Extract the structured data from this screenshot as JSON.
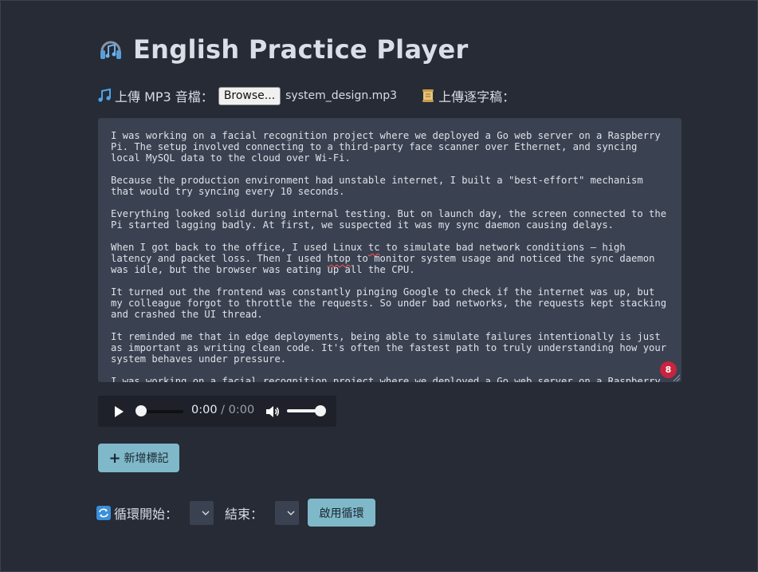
{
  "app": {
    "title": "English Practice Player",
    "title_icon": "headphones-icon"
  },
  "upload": {
    "mp3_label": "上傳 MP3 音檔：",
    "mp3_icon": "music-note-icon",
    "browse_label": "Browse...",
    "file_name": "system_design.mp3",
    "transcript_label": "上傳逐字稿：",
    "transcript_icon": "scroll-icon"
  },
  "transcript": {
    "paragraphs": [
      "I was working on a facial recognition project where we deployed a Go web server on a Raspberry Pi. The setup involved connecting to a third-party face scanner over Ethernet, and syncing local MySQL data to the cloud over Wi-Fi.",
      "Because the production environment had unstable internet, I built a \"best-effort\" mechanism that would try syncing every 10 seconds.",
      "Everything looked solid during internal testing. But on launch day, the screen connected to the Pi started lagging badly. At first, we suspected it was my sync daemon causing delays.",
      "When I got back to the office, I used Linux tc to simulate bad network conditions — high latency and packet loss. Then I used htop to monitor system usage and noticed the sync daemon was idle, but the browser was eating up all the CPU.",
      "It turned out the frontend was constantly pinging Google to check if the internet was up, but my colleague forgot to throttle the requests. So under bad networks, the requests kept stacking and crashed the UI thread.",
      "It reminded me that in edge deployments, being able to simulate failures intentionally is just as important as writing clean code. It's often the fastest path to truly understanding how your system behaves under pressure.",
      "I was working on a facial recognition project where we deployed a Go web server on a Raspberry"
    ],
    "spell_badge": "8"
  },
  "player": {
    "current_time": "0:00",
    "separator": "/",
    "duration": "0:00"
  },
  "markers": {
    "add_label": "新增標記"
  },
  "loop": {
    "start_label": "循環開始：",
    "end_label": "結束：",
    "enable_label": "啟用循環",
    "loop_icon": "repeat-icon"
  },
  "colors": {
    "background": "#262b36",
    "panel": "#3a4150",
    "accent": "#7fb8c8",
    "badge": "#c8243f"
  }
}
